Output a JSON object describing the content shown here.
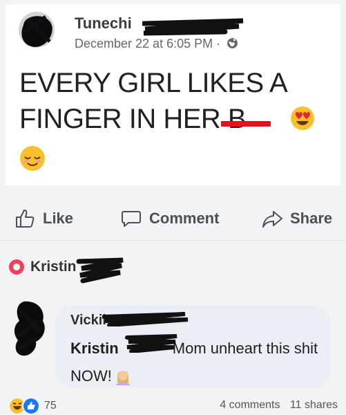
{
  "post": {
    "author_name": "Tunechi",
    "timestamp": "December 22 at 6:05 PM",
    "separator": "·",
    "privacy_icon": "globe-icon",
    "text_line1": "EVERY GIRL LIKES A",
    "text_line2": "FINGER IN HER B",
    "emojis": [
      "heart-eyes-emoji",
      "relieved-emoji"
    ]
  },
  "actions": {
    "like_label": "Like",
    "comment_label": "Comment",
    "share_label": "Share"
  },
  "reply_context": {
    "name": "Kristin"
  },
  "comment": {
    "author": "Vickii",
    "mention": "Kristin",
    "text": " Mom unheart this shit NOW!",
    "emoji": "woman-facepalming-emoji"
  },
  "footer": {
    "reaction_count": "75",
    "comments": "4 comments",
    "shares": "11 shares"
  },
  "colors": {
    "background": "#f2f3f5",
    "card": "#ffffff",
    "bubble": "#eceef6",
    "redaction": "#111111",
    "red_mark": "#e0141e",
    "like_blue": "#1877f2"
  }
}
